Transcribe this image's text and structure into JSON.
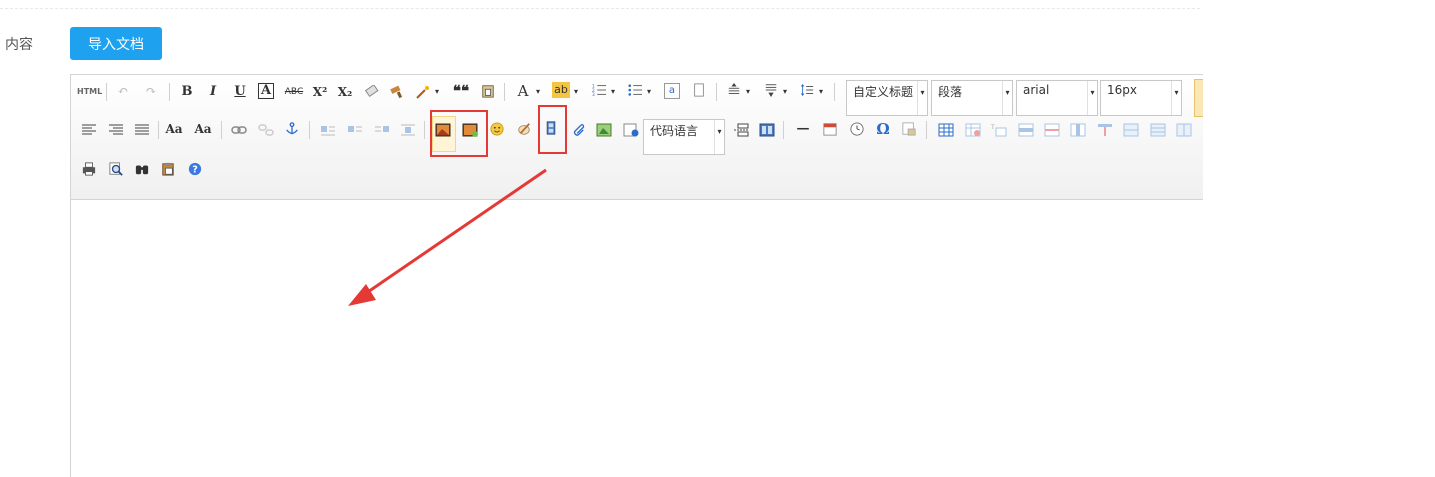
{
  "form": {
    "content_label": "内容",
    "import_button_label": "导入文档"
  },
  "toolbar": {
    "html_label": "HTML",
    "bold": "B",
    "italic": "I",
    "underline": "U",
    "font_border": "A",
    "strikethrough": "ABC",
    "superscript": "X²",
    "subscript": "X₂",
    "blockquote": "❝❝",
    "forecolor": "A",
    "backcolor": "ab",
    "omega": "Ω",
    "help": "?",
    "horizontal_rule": "—",
    "heading_select": "自定义标题",
    "paragraph_select": "段落",
    "font_family_select": "arial",
    "font_size_select": "16px",
    "code_language_select": "代码语言"
  },
  "accent_colors": {
    "import_button": "#1ea2f0",
    "highlight_border": "#e53935",
    "annotation_arrow": "#e53935"
  }
}
